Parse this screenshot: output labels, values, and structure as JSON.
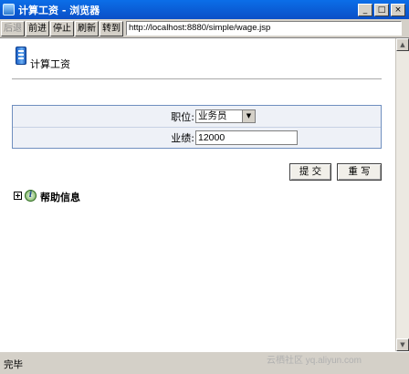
{
  "window": {
    "title": "计算工资 - 浏览器",
    "minimize_glyph": "_",
    "maximize_glyph": "□",
    "close_glyph": "×"
  },
  "toolbar": {
    "back_label": "后退",
    "forward_label": "前进",
    "stop_label": "停止",
    "refresh_label": "刷新",
    "goto_label": "转到",
    "url": "http://localhost:8880/simple/wage.jsp"
  },
  "page": {
    "title": "计算工资"
  },
  "form": {
    "position_label": "职位:",
    "position_selected": "业务员",
    "performance_label": "业绩:",
    "performance_value": "12000",
    "submit_label": "提 交",
    "reset_label": "重 写"
  },
  "help": {
    "label": "帮助信息"
  },
  "status": {
    "text": "完毕"
  },
  "watermark": {
    "text": "云栖社区 yq.aliyun.com"
  },
  "colors": {
    "titlebar": "#0a5ad6",
    "chrome": "#d4d0c8",
    "form_background": "#eef1f7",
    "form_border": "#6f8fbf"
  }
}
